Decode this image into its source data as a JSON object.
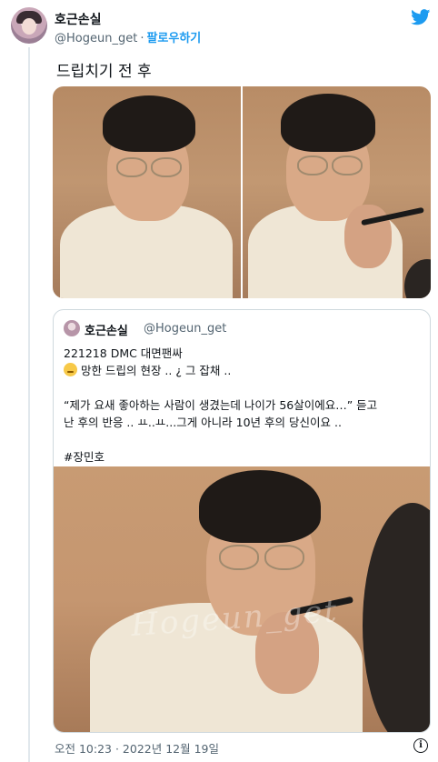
{
  "author": {
    "name": "호근손실",
    "handle": "@Hogeun_get",
    "separator": "·",
    "follow_label": "팔로우하기"
  },
  "tweet": {
    "text": "드립치기 전 후",
    "timestamp": "오전 10:23 · 2022년 12월 19일"
  },
  "quoted_tweet": {
    "name": "호근손실",
    "handle": "@Hogeun_get",
    "lines": [
      "221218 DMC 대면팬싸",
      "망한 드립의 현장 .. ¿ 그 잡채 ..",
      "",
      "“제가 요새 좋아하는 사람이 생겼는데 나이가 56살이에요…” 듣고",
      "난 후의 반응 .. ㅛ..ㅛ...그게 아니라 10년 후의 당신이요 ..",
      "",
      "#장민호"
    ],
    "watermark": "Hogeun_get"
  },
  "icons": {
    "brand": "twitter-bird-icon",
    "info": "info-icon",
    "emoji": "melting-face-emoji"
  },
  "colors": {
    "link": "#1d9bf0",
    "secondary_text": "#536471",
    "border": "#cfd9de"
  }
}
